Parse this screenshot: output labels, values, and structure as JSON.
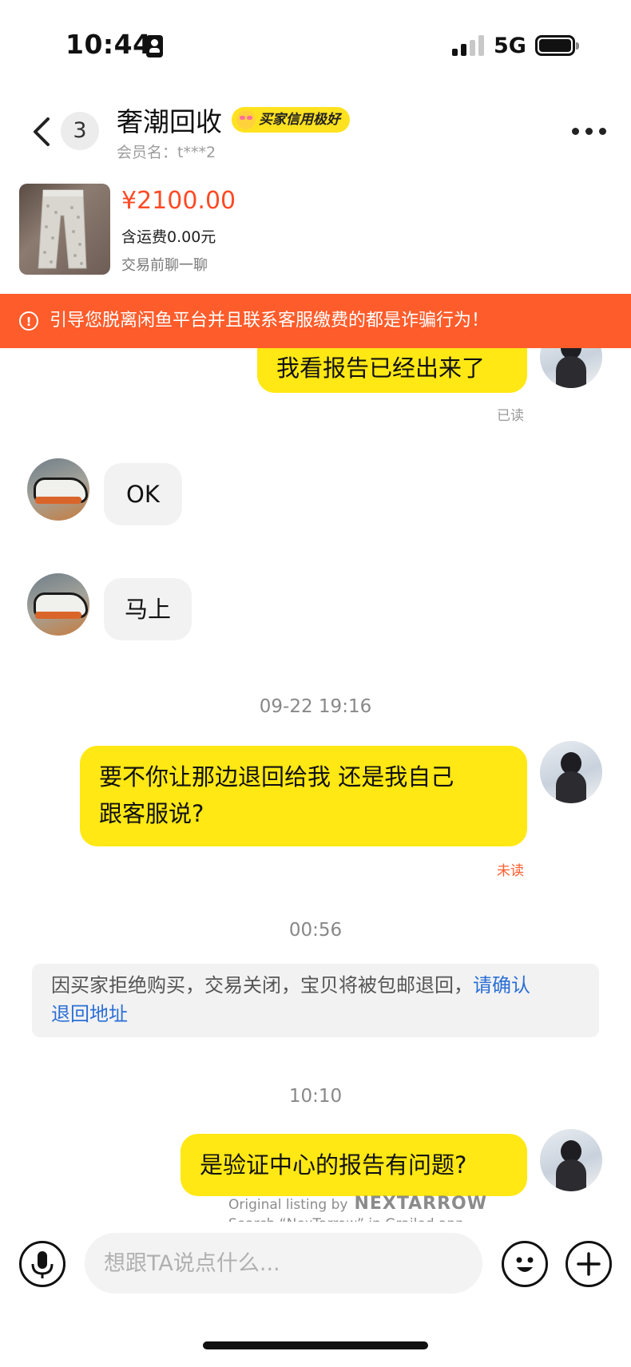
{
  "status_bar": {
    "time": "10:44",
    "network": "5G"
  },
  "header": {
    "unread_count": "3",
    "title": "奢潮回收",
    "credit_badge": "买家信用极好",
    "member_name": "会员名：t***2"
  },
  "product": {
    "price": "¥2100.00",
    "shipping": "含运费0.00元",
    "hint": "交易前聊一聊"
  },
  "warning": {
    "text": "引导您脱离闲鱼平台并且联系客服缴费的都是诈骗行为！"
  },
  "messages": [
    {
      "sender": "me",
      "text": "我看报告已经出来了",
      "status": "已读"
    },
    {
      "sender": "them",
      "text": "OK"
    },
    {
      "sender": "them",
      "text": "马上"
    },
    {
      "type": "timestamp",
      "text": "09-22 19:16"
    },
    {
      "sender": "me",
      "text_line1": "要不你让那边退回给我  还是我自己",
      "text_line2": "跟客服说?",
      "status": "未读"
    },
    {
      "type": "timestamp",
      "text": "00:56"
    },
    {
      "type": "system",
      "text": "因买家拒绝购买，交易关闭，宝贝将被包邮退回，",
      "link_line1": "请确认",
      "link_line2": "退回地址"
    },
    {
      "type": "timestamp",
      "text": "10:10"
    },
    {
      "sender": "me",
      "text": "是验证中心的报告有问题?"
    }
  ],
  "watermark": {
    "line1": "Original listing by",
    "brand": "NEXTARROW",
    "line2": "Search “NexTarrow” in Grailed app."
  },
  "input": {
    "placeholder": "想跟TA说点什么..."
  },
  "colors": {
    "accent_yellow": "#ffe814",
    "warning_orange": "#ff5c2b",
    "price_red": "#ff4a24",
    "link_blue": "#2a6fd6"
  },
  "icons": [
    "back-icon",
    "more-icon",
    "warning-icon",
    "mic-icon",
    "emoji-icon",
    "plus-icon"
  ]
}
